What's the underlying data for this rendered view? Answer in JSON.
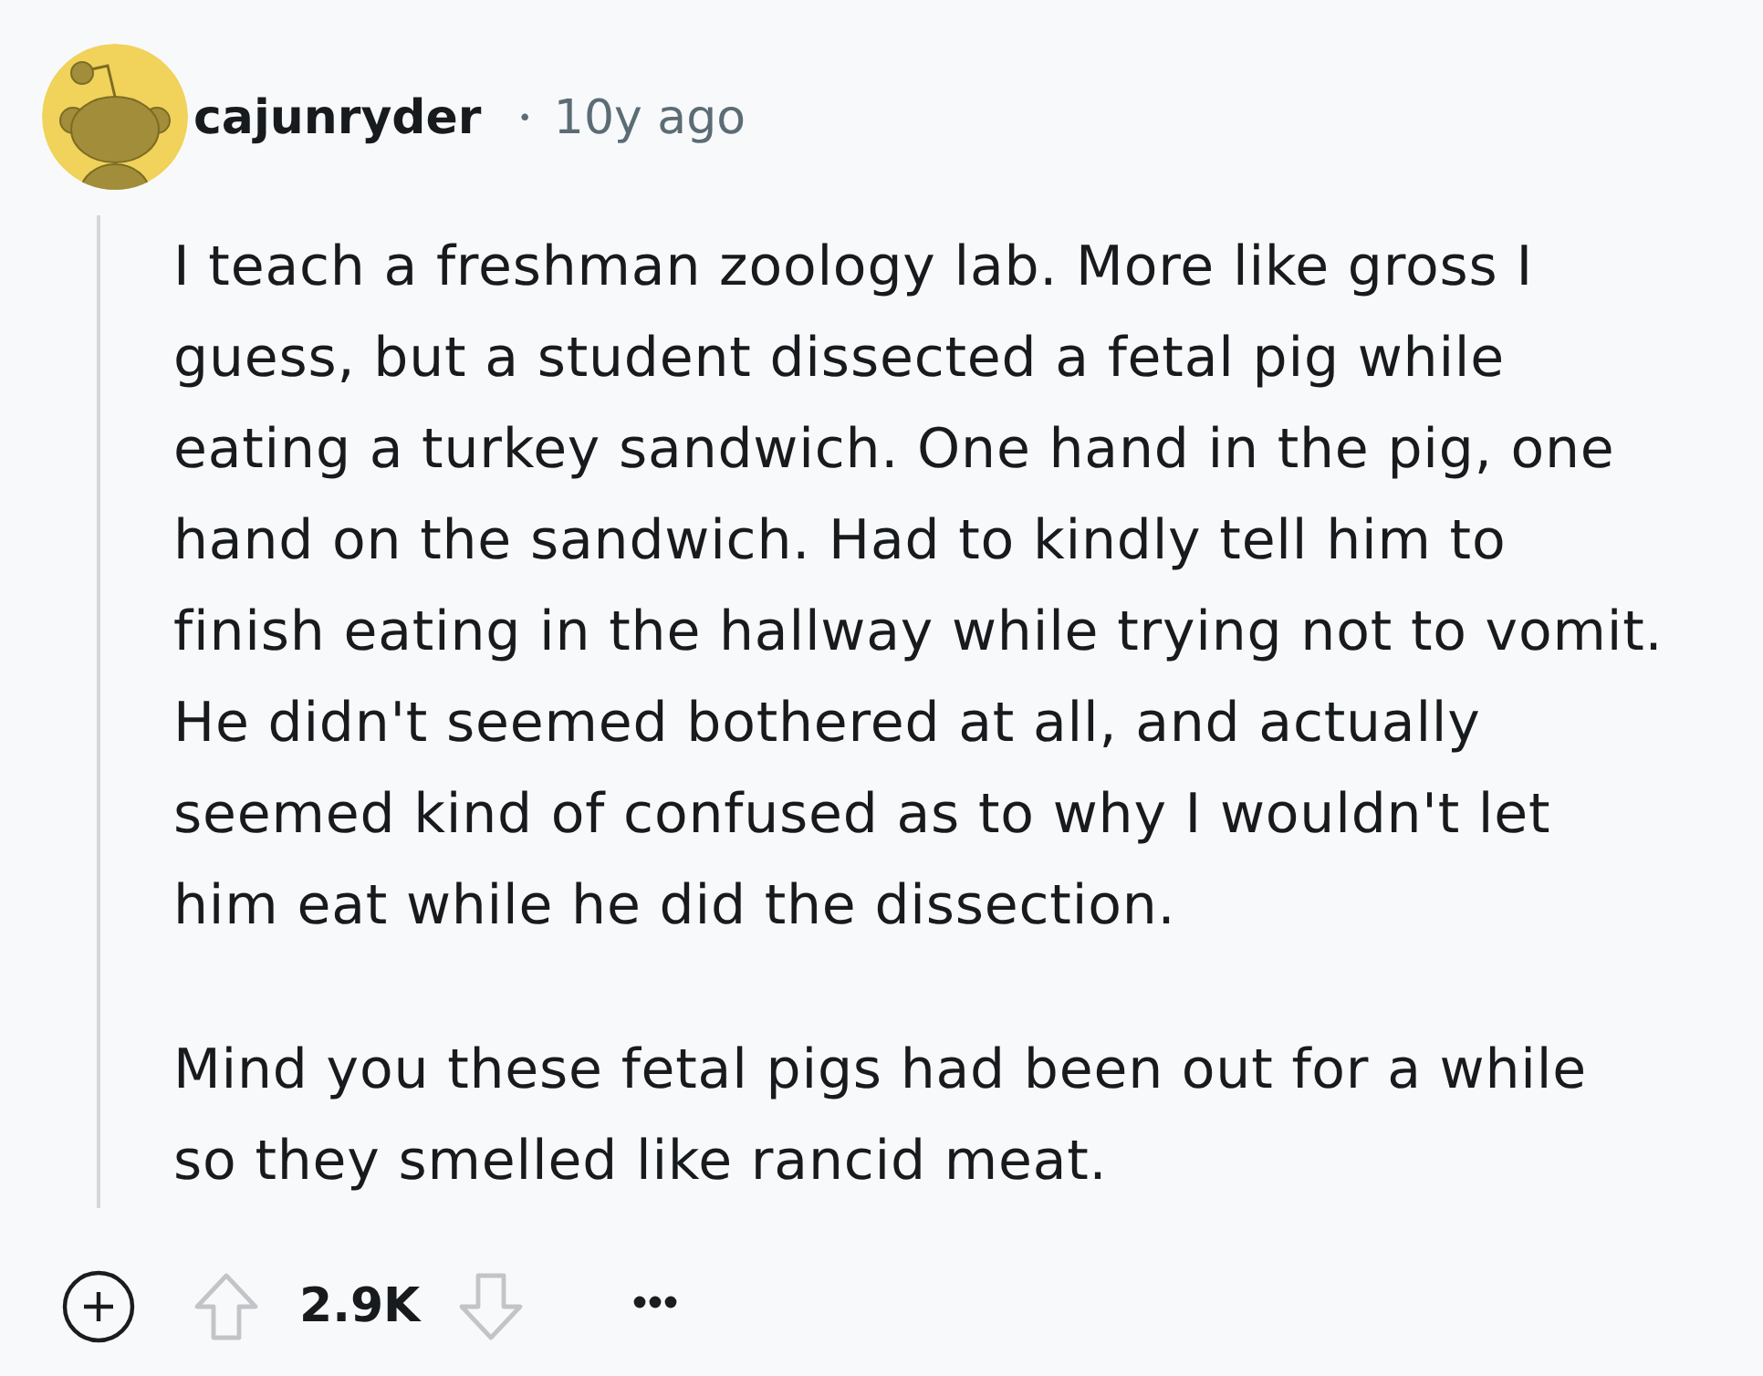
{
  "comment": {
    "author": "cajunryder",
    "separator": "•",
    "age": "10y ago",
    "paragraphs": [
      {
        "lines": [
          "I teach a freshman zoology lab. More like gross I",
          "guess, but a student dissected a fetal pig while",
          "eating a turkey sandwich. One hand in the pig, one",
          "hand on the sandwich. Had to kindly tell him to",
          "finish eating in the hallway while trying not to vomit.",
          "He didn't seemed bothered at all, and actually",
          "seemed kind of confused as to why I wouldn't let",
          "him eat while he did the dissection."
        ]
      },
      {
        "lines": [
          "Mind you these fetal pigs had been out for a while",
          "so they smelled like rancid meat."
        ]
      }
    ]
  },
  "actions": {
    "score": "2.9K"
  }
}
